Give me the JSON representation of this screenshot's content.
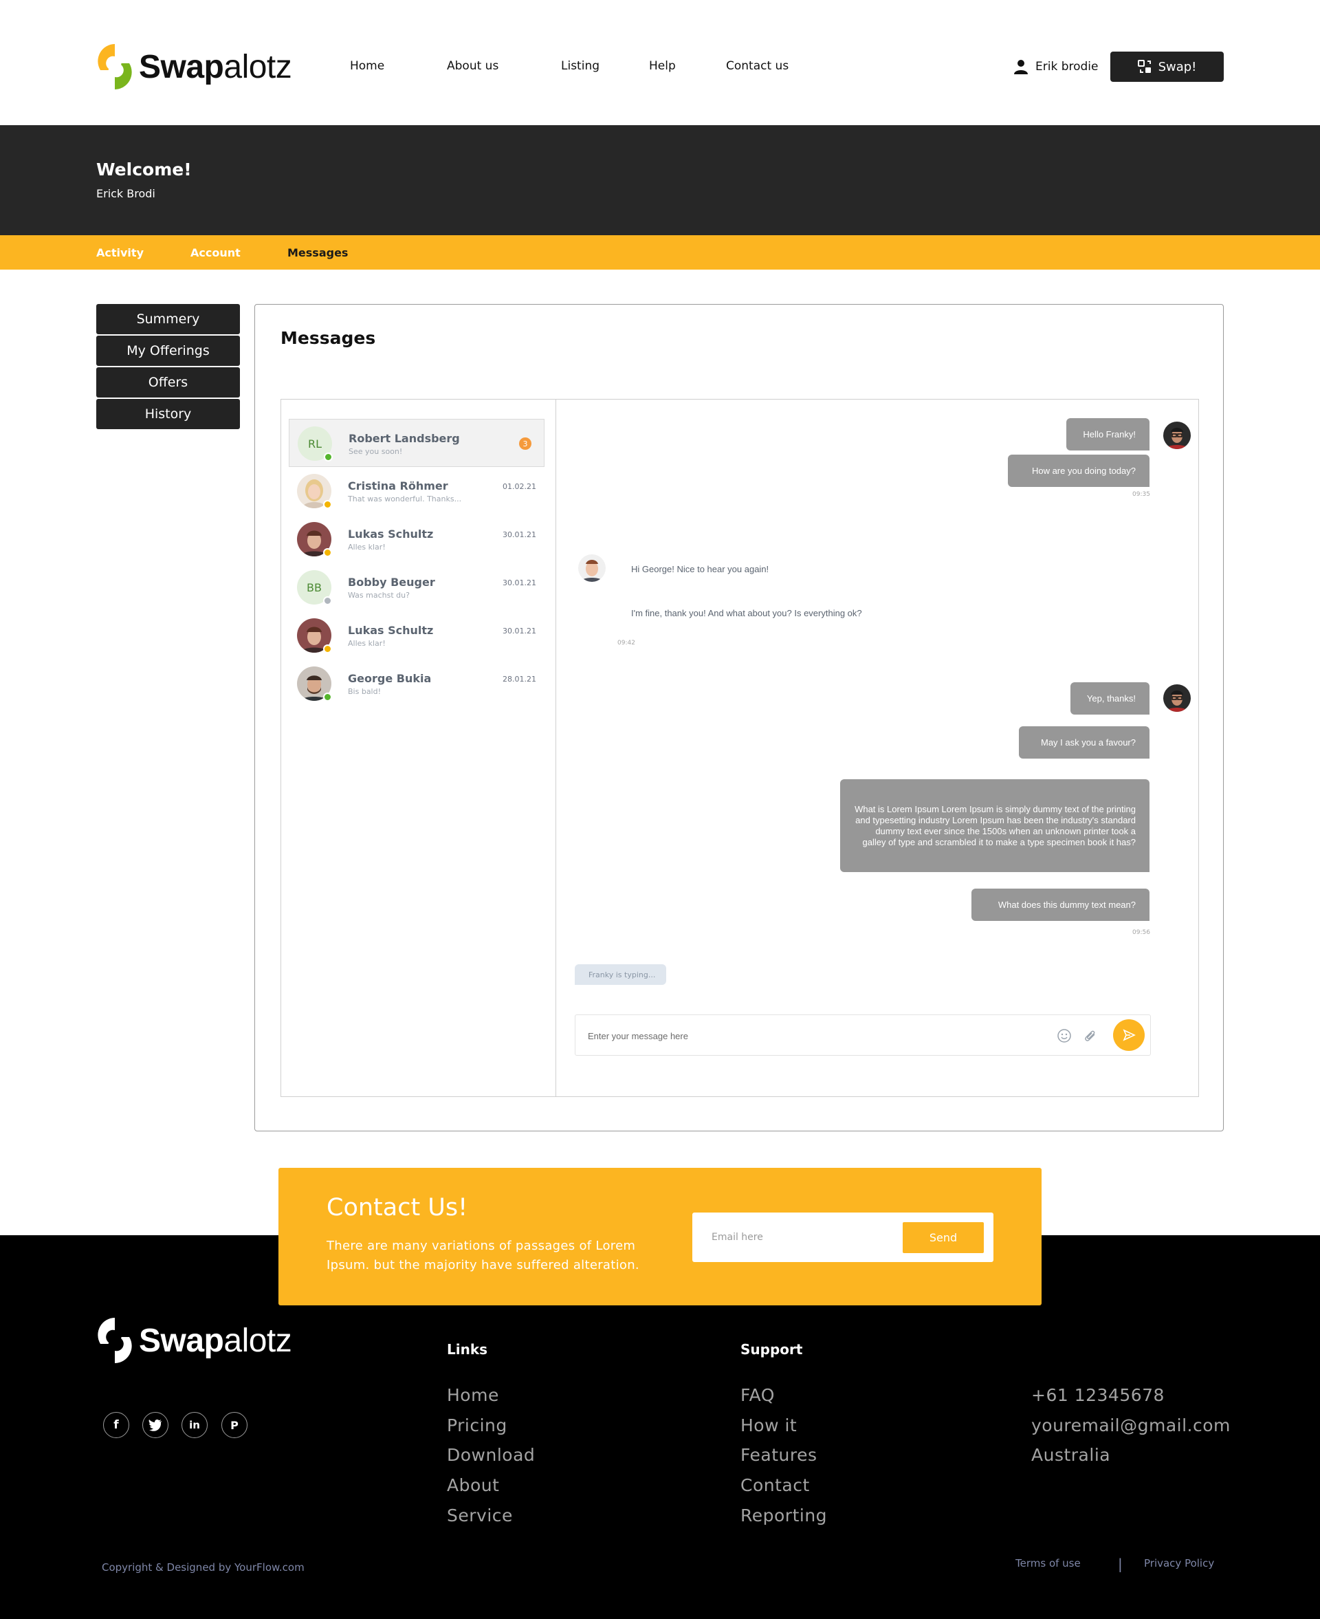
{
  "brand": {
    "name_bold": "Swap",
    "name_light": "alotz",
    "colors": {
      "accent": "#fcb521",
      "green": "#7ab51d",
      "dark": "#272727"
    }
  },
  "nav": {
    "items": [
      "Home",
      "About us",
      "Listing",
      "Help",
      "Contact us"
    ],
    "user_name": "Erik brodie",
    "swap_label": "Swap!"
  },
  "welcome": {
    "title": "Welcome!",
    "name": "Erick Brodi"
  },
  "tabs": [
    "Activity",
    "Account",
    "Messages"
  ],
  "side_menu": [
    "Summery",
    "My Offerings",
    "Offers",
    "History"
  ],
  "messages": {
    "title": "Messages",
    "conversations": [
      {
        "initials": "RL",
        "name": "Robert Landsberg",
        "preview": "See you soon!",
        "date": "",
        "unread": "3",
        "status_color": "#55b52d"
      },
      {
        "initials": "",
        "name": "Cristina Röhmer",
        "preview": "That was wonderful. Thanks...",
        "date": "01.02.21",
        "unread": "",
        "status_color": "#f4b400"
      },
      {
        "initials": "",
        "name": "Lukas Schultz",
        "preview": "Alles klar!",
        "date": "30.01.21",
        "unread": "",
        "status_color": "#f4b400"
      },
      {
        "initials": "BB",
        "name": "Bobby Beuger",
        "preview": "Was machst du?",
        "date": "30.01.21",
        "unread": "",
        "status_color": "#b0b6bd"
      },
      {
        "initials": "",
        "name": "Lukas Schultz",
        "preview": "Alles klar!",
        "date": "30.01.21",
        "unread": "",
        "status_color": "#f4b400"
      },
      {
        "initials": "",
        "name": "George Bukia",
        "preview": "Bis bald!",
        "date": "28.01.21",
        "unread": "",
        "status_color": "#55b52d"
      }
    ],
    "thread": {
      "out1": [
        "Hello Franky!",
        "How are you doing today?"
      ],
      "out1_time": "09:35",
      "in1": [
        "Hi George! Nice to hear you again!",
        "I'm fine, thank you! And what about you? Is everything ok?"
      ],
      "in1_time": "09:42",
      "out2": [
        "Yep, thanks!",
        "May I ask you a favour?",
        "What is Lorem Ipsum Lorem Ipsum is simply dummy text of the printing and typesetting industry Lorem Ipsum has been the industry's standard dummy text ever since the 1500s when an unknown printer took a galley of type and scrambled it to make a type specimen book it has?",
        "What does this dummy text mean?"
      ],
      "out2_time": "09:56",
      "typing": "Franky is typing..."
    },
    "composer_placeholder": "Enter your message here"
  },
  "contact": {
    "title": "Contact Us!",
    "text": "There are many variations of passages of Lorem Ipsum. but the majority have suffered alteration.",
    "email_placeholder": "Email here",
    "send_label": "Send"
  },
  "footer": {
    "links_heading": "Links",
    "links": [
      "Home",
      "Pricing",
      "Download",
      "About",
      "Service"
    ],
    "support_heading": "Support",
    "support": [
      "FAQ",
      "How it",
      "Features",
      "Contact",
      "Reporting"
    ],
    "contact_info": [
      "+61 12345678",
      "youremail@gmail.com",
      "Australia"
    ],
    "social": [
      "facebook-icon",
      "twitter-icon",
      "linkedin-icon",
      "pinterest-icon"
    ],
    "copyright": "Copyright & Designed by YourFlow.com",
    "terms": "Terms of use",
    "separator": "|",
    "privacy": "Privacy  Policy"
  }
}
